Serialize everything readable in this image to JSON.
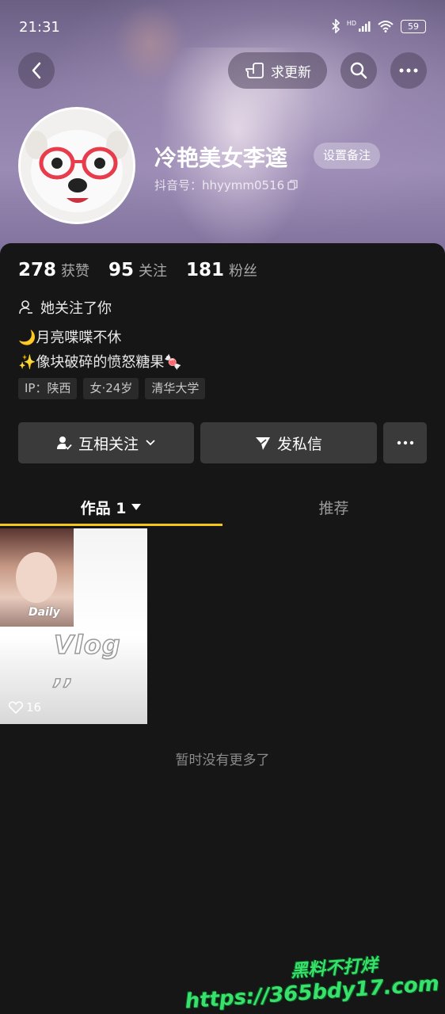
{
  "status_bar": {
    "time": "21:31",
    "network": "HD",
    "battery": "59"
  },
  "header": {
    "request_update_label": "求更新",
    "username": "冷艳美女李逵",
    "remark_label": "设置备注",
    "douyin_id": "抖音号：hhyymm0516"
  },
  "stats": [
    {
      "value": "278",
      "label": "获赞"
    },
    {
      "value": "95",
      "label": "关注"
    },
    {
      "value": "181",
      "label": "粉丝"
    }
  ],
  "profile": {
    "follows_you": "她关注了你",
    "bio_line1": "🌙月亮喋喋不休",
    "bio_line2": "✨像块破碎的愤怒糖果🍬",
    "tags": [
      "IP：陕西",
      "女·24岁",
      "清华大学"
    ]
  },
  "actions": {
    "mutual_follow": "互相关注",
    "send_message": "发私信"
  },
  "tabs": {
    "works": "作品 1",
    "recommend": "推荐"
  },
  "video": {
    "daily_text": "Daily",
    "vlog_text": "Vlog ,,",
    "likes": "16"
  },
  "footer": {
    "no_more": "暂时没有更多了"
  },
  "watermark": {
    "line1": "黑料不打烊",
    "line2": "https://365bdy17.com"
  },
  "colors": {
    "accent_underline": "#f5c518",
    "background": "#161616",
    "button_bg": "#3a3a3a"
  }
}
